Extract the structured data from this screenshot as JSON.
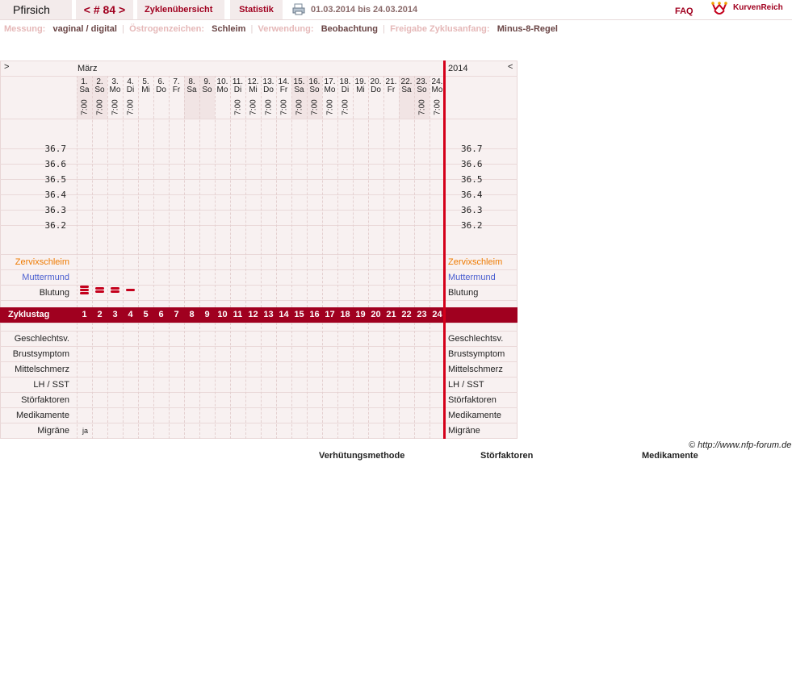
{
  "header": {
    "user_name": "Pfirsich",
    "cycle_nav": "< # 84 >",
    "tabs": [
      "Zyklenübersicht",
      "Statistik"
    ],
    "date_range": "01.03.2014 bis 24.03.2014",
    "faq": "FAQ",
    "logo_text": "KurvenReich"
  },
  "info": {
    "messung_label": "Messung:",
    "messung_value": "vaginal / digital",
    "oestrogen_label": "Östrogenzeichen:",
    "oestrogen_value": "Schleim",
    "verwendung_label": "Verwendung:",
    "verwendung_value": "Beobachtung",
    "freigabe_label": "Freigabe Zyklusanfang:",
    "freigabe_value": "Minus-8-Regel"
  },
  "chart": {
    "nav_prev": ">",
    "nav_next": "<",
    "month": "März",
    "year": "2014",
    "days": [
      {
        "num": "1.",
        "wd": "Sa",
        "time": "7:00",
        "weekend": true
      },
      {
        "num": "2.",
        "wd": "So",
        "time": "7:00",
        "weekend": true
      },
      {
        "num": "3.",
        "wd": "Mo",
        "time": "7:00",
        "weekend": false
      },
      {
        "num": "4.",
        "wd": "Di",
        "time": "7:00",
        "weekend": false
      },
      {
        "num": "5.",
        "wd": "Mi",
        "time": "",
        "weekend": false
      },
      {
        "num": "6.",
        "wd": "Do",
        "time": "",
        "weekend": false
      },
      {
        "num": "7.",
        "wd": "Fr",
        "time": "",
        "weekend": false
      },
      {
        "num": "8.",
        "wd": "Sa",
        "time": "",
        "weekend": true
      },
      {
        "num": "9.",
        "wd": "So",
        "time": "",
        "weekend": true
      },
      {
        "num": "10.",
        "wd": "Mo",
        "time": "",
        "weekend": false
      },
      {
        "num": "11.",
        "wd": "Di",
        "time": "7:00",
        "weekend": false
      },
      {
        "num": "12.",
        "wd": "Mi",
        "time": "7:00",
        "weekend": false
      },
      {
        "num": "13.",
        "wd": "Do",
        "time": "7:00",
        "weekend": false
      },
      {
        "num": "14.",
        "wd": "Fr",
        "time": "7:00",
        "weekend": false
      },
      {
        "num": "15.",
        "wd": "Sa",
        "time": "7:00",
        "weekend": true
      },
      {
        "num": "16.",
        "wd": "So",
        "time": "7:00",
        "weekend": true
      },
      {
        "num": "17.",
        "wd": "Mo",
        "time": "7:00",
        "weekend": false
      },
      {
        "num": "18.",
        "wd": "Di",
        "time": "7:00",
        "weekend": false
      },
      {
        "num": "19.",
        "wd": "Mi",
        "time": "",
        "weekend": false
      },
      {
        "num": "20.",
        "wd": "Do",
        "time": "",
        "weekend": false
      },
      {
        "num": "21.",
        "wd": "Fr",
        "time": "",
        "weekend": false
      },
      {
        "num": "22.",
        "wd": "Sa",
        "time": "",
        "weekend": true
      },
      {
        "num": "23.",
        "wd": "So",
        "time": "7:00",
        "weekend": true
      },
      {
        "num": "24.",
        "wd": "Mo",
        "time": "7:00",
        "weekend": false
      }
    ],
    "temperatures": [
      "36.7",
      "36.6",
      "36.5",
      "36.4",
      "36.3",
      "36.2"
    ],
    "rows_top": [
      {
        "label": "Zervixschleim",
        "color": "#ee7a00"
      },
      {
        "label": "Muttermund",
        "color": "#4a5fd0"
      },
      {
        "label": "Blutung",
        "color": "#222222"
      }
    ],
    "blutung": [
      3,
      2,
      2,
      1
    ],
    "cycle_day_label": "Zyklustag",
    "cycle_days": [
      "1",
      "2",
      "3",
      "4",
      "5",
      "6",
      "7",
      "8",
      "9",
      "10",
      "11",
      "12",
      "13",
      "14",
      "15",
      "16",
      "17",
      "18",
      "19",
      "20",
      "21",
      "22",
      "23",
      "24"
    ],
    "rows_bottom": [
      "Geschlechtsv.",
      "Brustsymptom",
      "Mittelschmerz",
      "LH / SST",
      "Störfaktoren",
      "Medikamente",
      "Migräne"
    ],
    "migraene_day1": "ja"
  },
  "footer": {
    "copyright": "© http://www.nfp-forum.de",
    "legend_headers": [
      "Verhütungsmethode",
      "Störfaktoren",
      "Medikamente"
    ]
  },
  "colors": {
    "accent": "#a0001f",
    "redline": "#d4001a",
    "background_pink": "#f8f1f1"
  }
}
